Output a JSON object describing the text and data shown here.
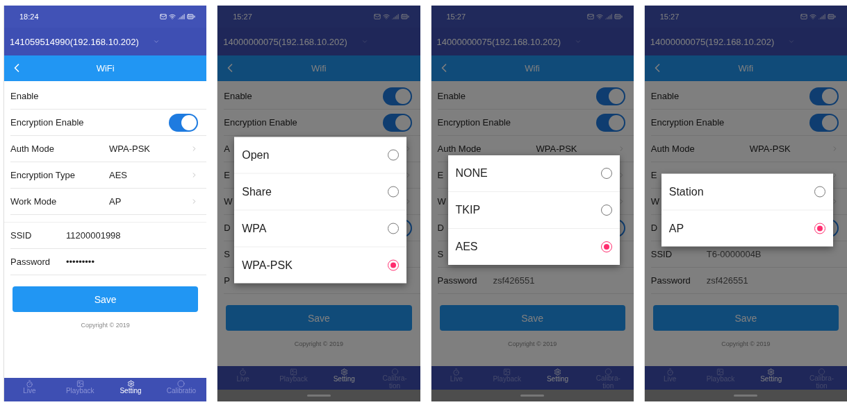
{
  "phones": [
    {
      "status_time": "18:24",
      "device": "141059514990(192.168.10.202)",
      "title": "WiFi",
      "home_indicator": false,
      "sections": [
        [
          {
            "kind": "plain",
            "label": "Enable"
          },
          {
            "kind": "toggle",
            "label": "Encryption Enable",
            "on": true
          },
          {
            "kind": "select",
            "label": "Auth Mode",
            "value": "WPA-PSK"
          },
          {
            "kind": "select",
            "label": "Encryption Type",
            "value": "AES"
          },
          {
            "kind": "select",
            "label": "Work Mode",
            "value": "AP"
          }
        ],
        [
          {
            "kind": "field",
            "label": "SSID",
            "value": "11200001998"
          },
          {
            "kind": "field",
            "label": "Password",
            "value": "•••••••••"
          }
        ]
      ],
      "save": "Save",
      "copyright": "Copyright © 2019",
      "nav": [
        {
          "label": "Live",
          "selected": false
        },
        {
          "label": "Playback",
          "selected": false
        },
        {
          "label": "Setting",
          "selected": true
        },
        {
          "label": "Calibratio",
          "selected": false
        }
      ]
    },
    {
      "status_time": "15:27",
      "device": "14000000075(192.168.10.202)",
      "title": "Wifi",
      "home_indicator": true,
      "sections": [
        [
          {
            "kind": "toggle",
            "label": "Enable",
            "on": true
          },
          {
            "kind": "toggle",
            "label": "Encryption Enable",
            "on": true
          },
          {
            "kind": "select",
            "label": "A"
          },
          {
            "kind": "select",
            "label": "E"
          },
          {
            "kind": "select",
            "label": "W"
          },
          {
            "kind": "toggle",
            "label": "D",
            "on": true
          },
          {
            "kind": "field",
            "label": "S"
          },
          {
            "kind": "field",
            "label": "P"
          }
        ]
      ],
      "save": "Save",
      "copyright": "Copyright © 2019",
      "nav": [
        {
          "label": "Live",
          "selected": false
        },
        {
          "label": "Playback",
          "selected": false
        },
        {
          "label": "Setting",
          "selected": true
        },
        {
          "label": "Calibra-tion",
          "selected": false
        }
      ],
      "dialog": {
        "options": [
          {
            "label": "Open",
            "selected": false
          },
          {
            "label": "Share",
            "selected": false
          },
          {
            "label": "WPA",
            "selected": false
          },
          {
            "label": "WPA-PSK",
            "selected": true
          }
        ]
      }
    },
    {
      "status_time": "15:27",
      "device": "14000000075(192.168.10.202)",
      "title": "Wifi",
      "home_indicator": true,
      "sections": [
        [
          {
            "kind": "toggle",
            "label": "Enable",
            "on": true
          },
          {
            "kind": "toggle",
            "label": "Encryption Enable",
            "on": true
          },
          {
            "kind": "select",
            "label": "Auth Mode",
            "value": "WPA-PSK"
          },
          {
            "kind": "select",
            "label": "E"
          },
          {
            "kind": "select",
            "label": "W"
          },
          {
            "kind": "toggle",
            "label": "D",
            "on": true
          },
          {
            "kind": "field",
            "label": "S"
          },
          {
            "kind": "field",
            "label": "Password",
            "value": "zsf426551"
          }
        ]
      ],
      "save": "Save",
      "copyright": "Copyright © 2019",
      "nav": [
        {
          "label": "Live",
          "selected": false
        },
        {
          "label": "Playback",
          "selected": false
        },
        {
          "label": "Setting",
          "selected": true
        },
        {
          "label": "Calibra-tion",
          "selected": false
        }
      ],
      "dialog": {
        "options": [
          {
            "label": "NONE",
            "selected": false
          },
          {
            "label": "TKIP",
            "selected": false
          },
          {
            "label": "AES",
            "selected": true
          }
        ]
      }
    },
    {
      "status_time": "15:27",
      "device": "14000000075(192.168.10.202)",
      "title": "Wifi",
      "home_indicator": true,
      "sections": [
        [
          {
            "kind": "toggle",
            "label": "Enable",
            "on": true
          },
          {
            "kind": "toggle",
            "label": "Encryption Enable",
            "on": true
          },
          {
            "kind": "select",
            "label": "Auth Mode",
            "value": "WPA-PSK"
          },
          {
            "kind": "select",
            "label": "E"
          },
          {
            "kind": "select",
            "label": "W"
          },
          {
            "kind": "toggle",
            "label": "D",
            "on": true
          },
          {
            "kind": "field",
            "label": "SSID",
            "value": "T6-0000004B"
          },
          {
            "kind": "field",
            "label": "Password",
            "value": "zsf426551"
          }
        ]
      ],
      "save": "Save",
      "copyright": "Copyright © 2019",
      "nav": [
        {
          "label": "Live",
          "selected": false
        },
        {
          "label": "Playback",
          "selected": false
        },
        {
          "label": "Setting",
          "selected": true
        },
        {
          "label": "Calibra-tion",
          "selected": false
        }
      ],
      "dialog": {
        "options": [
          {
            "label": "Station",
            "selected": false
          },
          {
            "label": "AP",
            "selected": true
          }
        ]
      }
    }
  ]
}
